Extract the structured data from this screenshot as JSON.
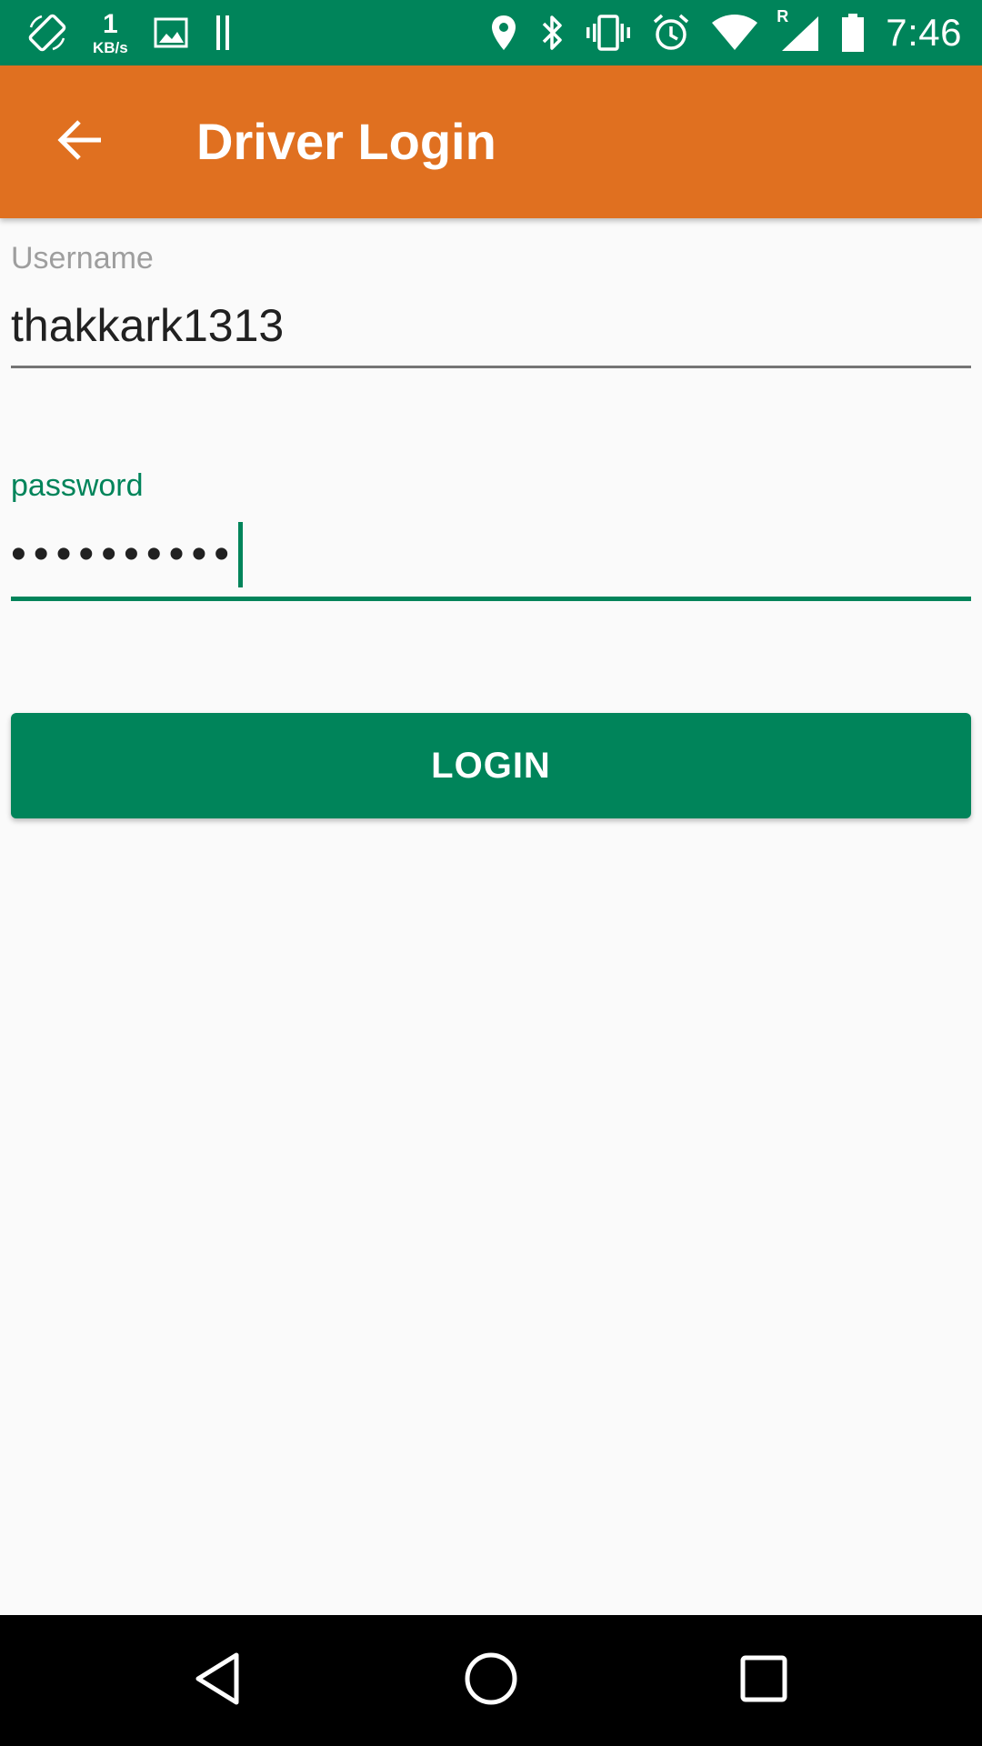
{
  "status_bar": {
    "speed_value": "1",
    "speed_unit": "KB/s",
    "time": "7:46",
    "roaming_indicator": "R",
    "left_icons": [
      "screen-rotation-icon",
      "image-icon",
      "pause-bars-icon"
    ],
    "right_icons": [
      "location-icon",
      "bluetooth-icon",
      "vibrate-icon",
      "alarm-icon",
      "wifi-icon",
      "signal-icon",
      "battery-icon"
    ]
  },
  "app_bar": {
    "title": "Driver Login",
    "back_icon": "arrow-back-icon"
  },
  "form": {
    "username_label": "Username",
    "username_value": "thakkark1313",
    "password_label": "password",
    "password_masked": "••••••••••",
    "login_label": "LOGIN"
  },
  "nav_bar": {
    "icons": [
      "back-triangle-icon",
      "home-circle-icon",
      "recents-square-icon"
    ]
  },
  "colors": {
    "status_bar": "#00845a",
    "app_bar": "#e07020",
    "accent": "#00845a",
    "background": "#fafafa",
    "nav_bar": "#000000"
  }
}
